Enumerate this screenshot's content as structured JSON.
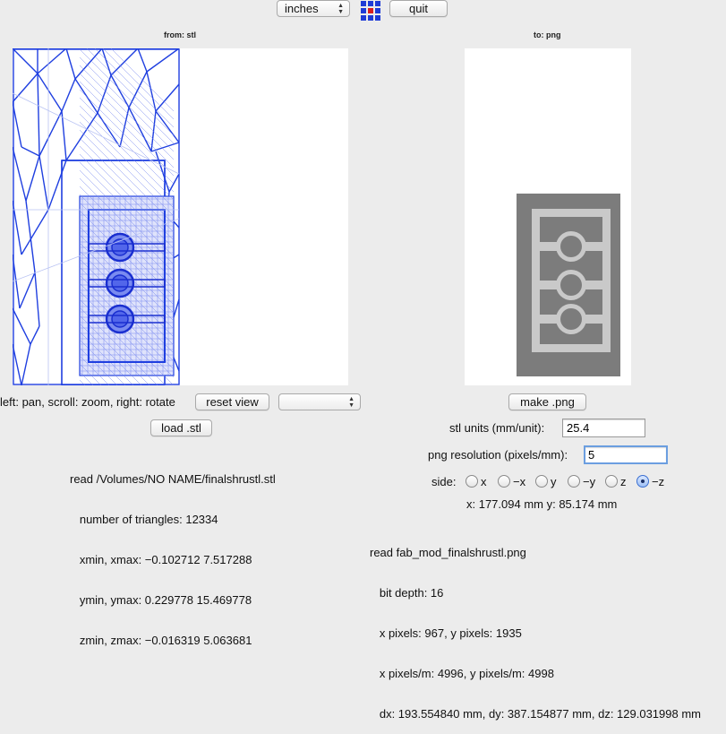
{
  "toolbar": {
    "units_select": "inches",
    "quit_label": "quit",
    "logo_colors": [
      "#1e3bd6",
      "#1e3bd6",
      "#1e3bd6",
      "#1e3bd6",
      "#d81e1e",
      "#1e3bd6",
      "#1e3bd6",
      "#1e3bd6",
      "#1e3bd6"
    ]
  },
  "left": {
    "heading": "from: stl",
    "mouse_help": "left: pan, scroll: zoom, right: rotate",
    "reset_view_label": "reset view",
    "view_select": "",
    "load_label": "load .stl",
    "info_lines": [
      "read /Volumes/NO NAME/finalshrustl.stl",
      "   number of triangles: 12334",
      "   xmin, xmax: −0.102712 7.517288",
      "   ymin, ymax: 0.229778 15.469778",
      "   zmin, zmax: −0.016319 5.063681"
    ],
    "mesh_color": "#1f3fe0"
  },
  "right": {
    "heading": "to: png",
    "make_label": "make .png",
    "stl_units_label": "stl units (mm/unit):",
    "stl_units_value": "25.4",
    "resolution_label": "png resolution (pixels/mm):",
    "resolution_value": "5",
    "side_label": "side:",
    "sides": [
      "x",
      "−x",
      "y",
      "−y",
      "z",
      "−z"
    ],
    "selected_side": "−z",
    "coords": "x: 177.094 mm  y: 85.174 mm",
    "info_lines": [
      "read fab_mod_finalshrustl.png",
      "   bit depth: 16",
      "   x pixels: 967, y pixels: 1935",
      "   x pixels/m: 4996, y pixels/m: 4998",
      "   dx: 193.554840 mm, dy: 387.154877 mm, dz: 129.031998 mm"
    ],
    "preview_dark": "#7c7c7c",
    "preview_light": "#c9c9c9"
  }
}
